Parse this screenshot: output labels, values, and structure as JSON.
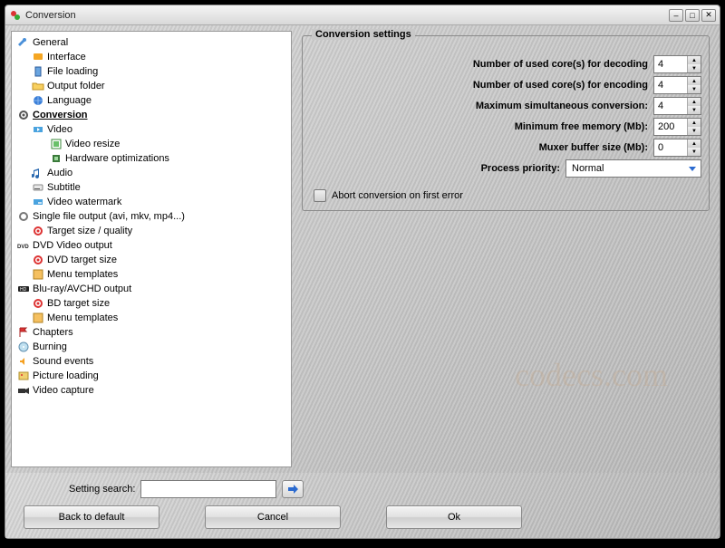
{
  "window": {
    "title": "Conversion"
  },
  "tree": {
    "general": "General",
    "interface": "Interface",
    "file_loading": "File loading",
    "output_folder": "Output folder",
    "language": "Language",
    "conversion": "Conversion",
    "video": "Video",
    "video_resize": "Video resize",
    "hw_opt": "Hardware optimizations",
    "audio": "Audio",
    "subtitle": "Subtitle",
    "video_watermark": "Video watermark",
    "single_file": "Single file output (avi, mkv, mp4...)",
    "target_size_quality": "Target size / quality",
    "dvd_output": "DVD Video output",
    "dvd_target": "DVD target size",
    "menu_templates_dvd": "Menu templates",
    "bluray_output": "Blu-ray/AVCHD output",
    "bd_target": "BD target size",
    "menu_templates_bd": "Menu templates",
    "chapters": "Chapters",
    "burning": "Burning",
    "sound_events": "Sound events",
    "picture_loading": "Picture loading",
    "video_capture": "Video capture"
  },
  "settings": {
    "legend": "Conversion settings",
    "decoding_cores_label": "Number of used core(s) for decoding",
    "decoding_cores_value": "4",
    "encoding_cores_label": "Number of used core(s) for encoding",
    "encoding_cores_value": "4",
    "max_simul_label": "Maximum simultaneous conversion:",
    "max_simul_value": "4",
    "min_mem_label": "Minimum free memory (Mb):",
    "min_mem_value": "200",
    "muxer_label": "Muxer buffer size (Mb):",
    "muxer_value": "0",
    "priority_label": "Process priority:",
    "priority_value": "Normal",
    "abort_label": "Abort conversion on first error"
  },
  "footer": {
    "search_label": "Setting search:",
    "search_value": "",
    "back_to_default": "Back to default",
    "cancel": "Cancel",
    "ok": "Ok"
  },
  "watermark": "codecs.com"
}
